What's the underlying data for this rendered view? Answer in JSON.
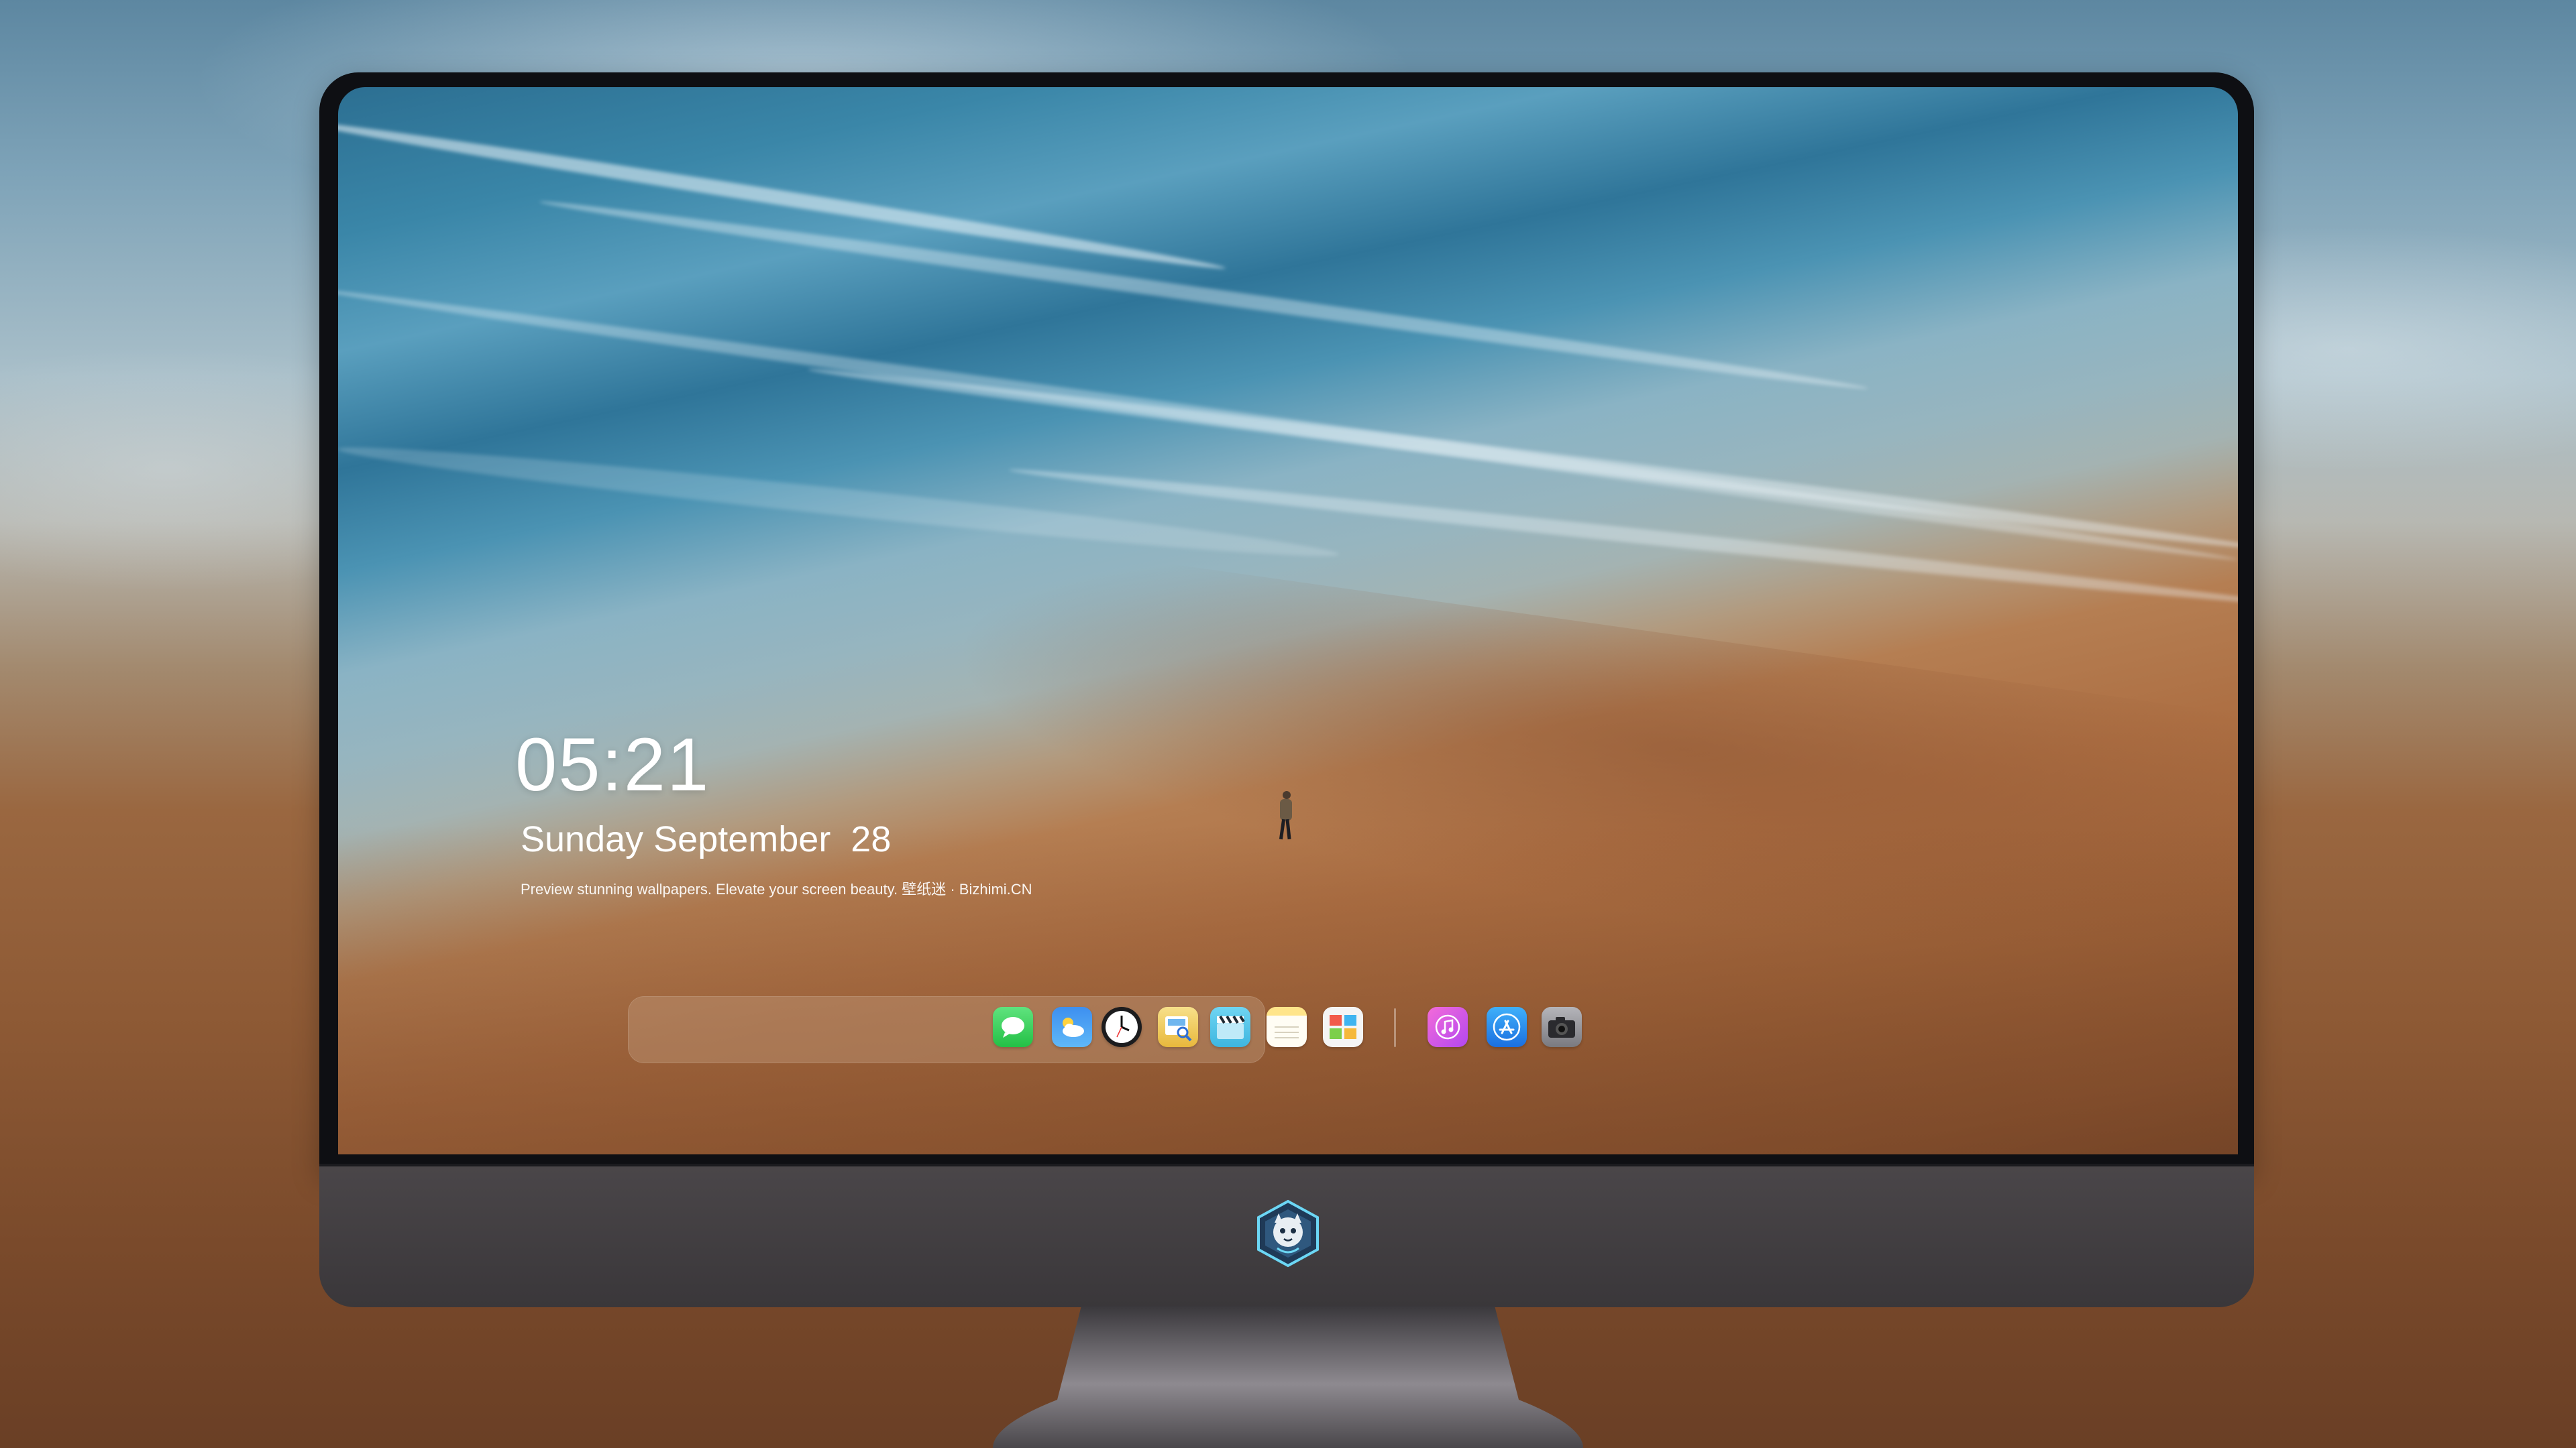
{
  "lockscreen": {
    "time": "05:21",
    "date": "Sunday September  28",
    "tagline": "Preview stunning wallpapers. Elevate your screen beauty. 壁纸迷 · Bizhimi.CN"
  },
  "dock": {
    "apps": [
      {
        "icon": "messages-icon",
        "color": "#2fd158"
      },
      {
        "icon": "weather-icon",
        "color": "#3fa0f5"
      },
      {
        "icon": "clock-icon",
        "color": "#ffffff"
      },
      {
        "icon": "preview-icon",
        "color": "#f2c84b"
      },
      {
        "icon": "clapperboard-icon",
        "color": "#4ec3e8"
      },
      {
        "icon": "notes-icon",
        "color": "#ffd54a"
      },
      {
        "icon": "photo-booth-icon",
        "color": "#ffffff"
      },
      {
        "icon": "itunes-icon",
        "color": "#d84cf0"
      },
      {
        "icon": "app-store-icon",
        "color": "#2a8cf3"
      },
      {
        "icon": "camera-icon",
        "color": "#8e8e93"
      }
    ]
  },
  "colors": {
    "bezel": "#0e0f13",
    "chin": "#3f3c3f",
    "sea": "#2c6f92",
    "sand": "#a8693e"
  }
}
